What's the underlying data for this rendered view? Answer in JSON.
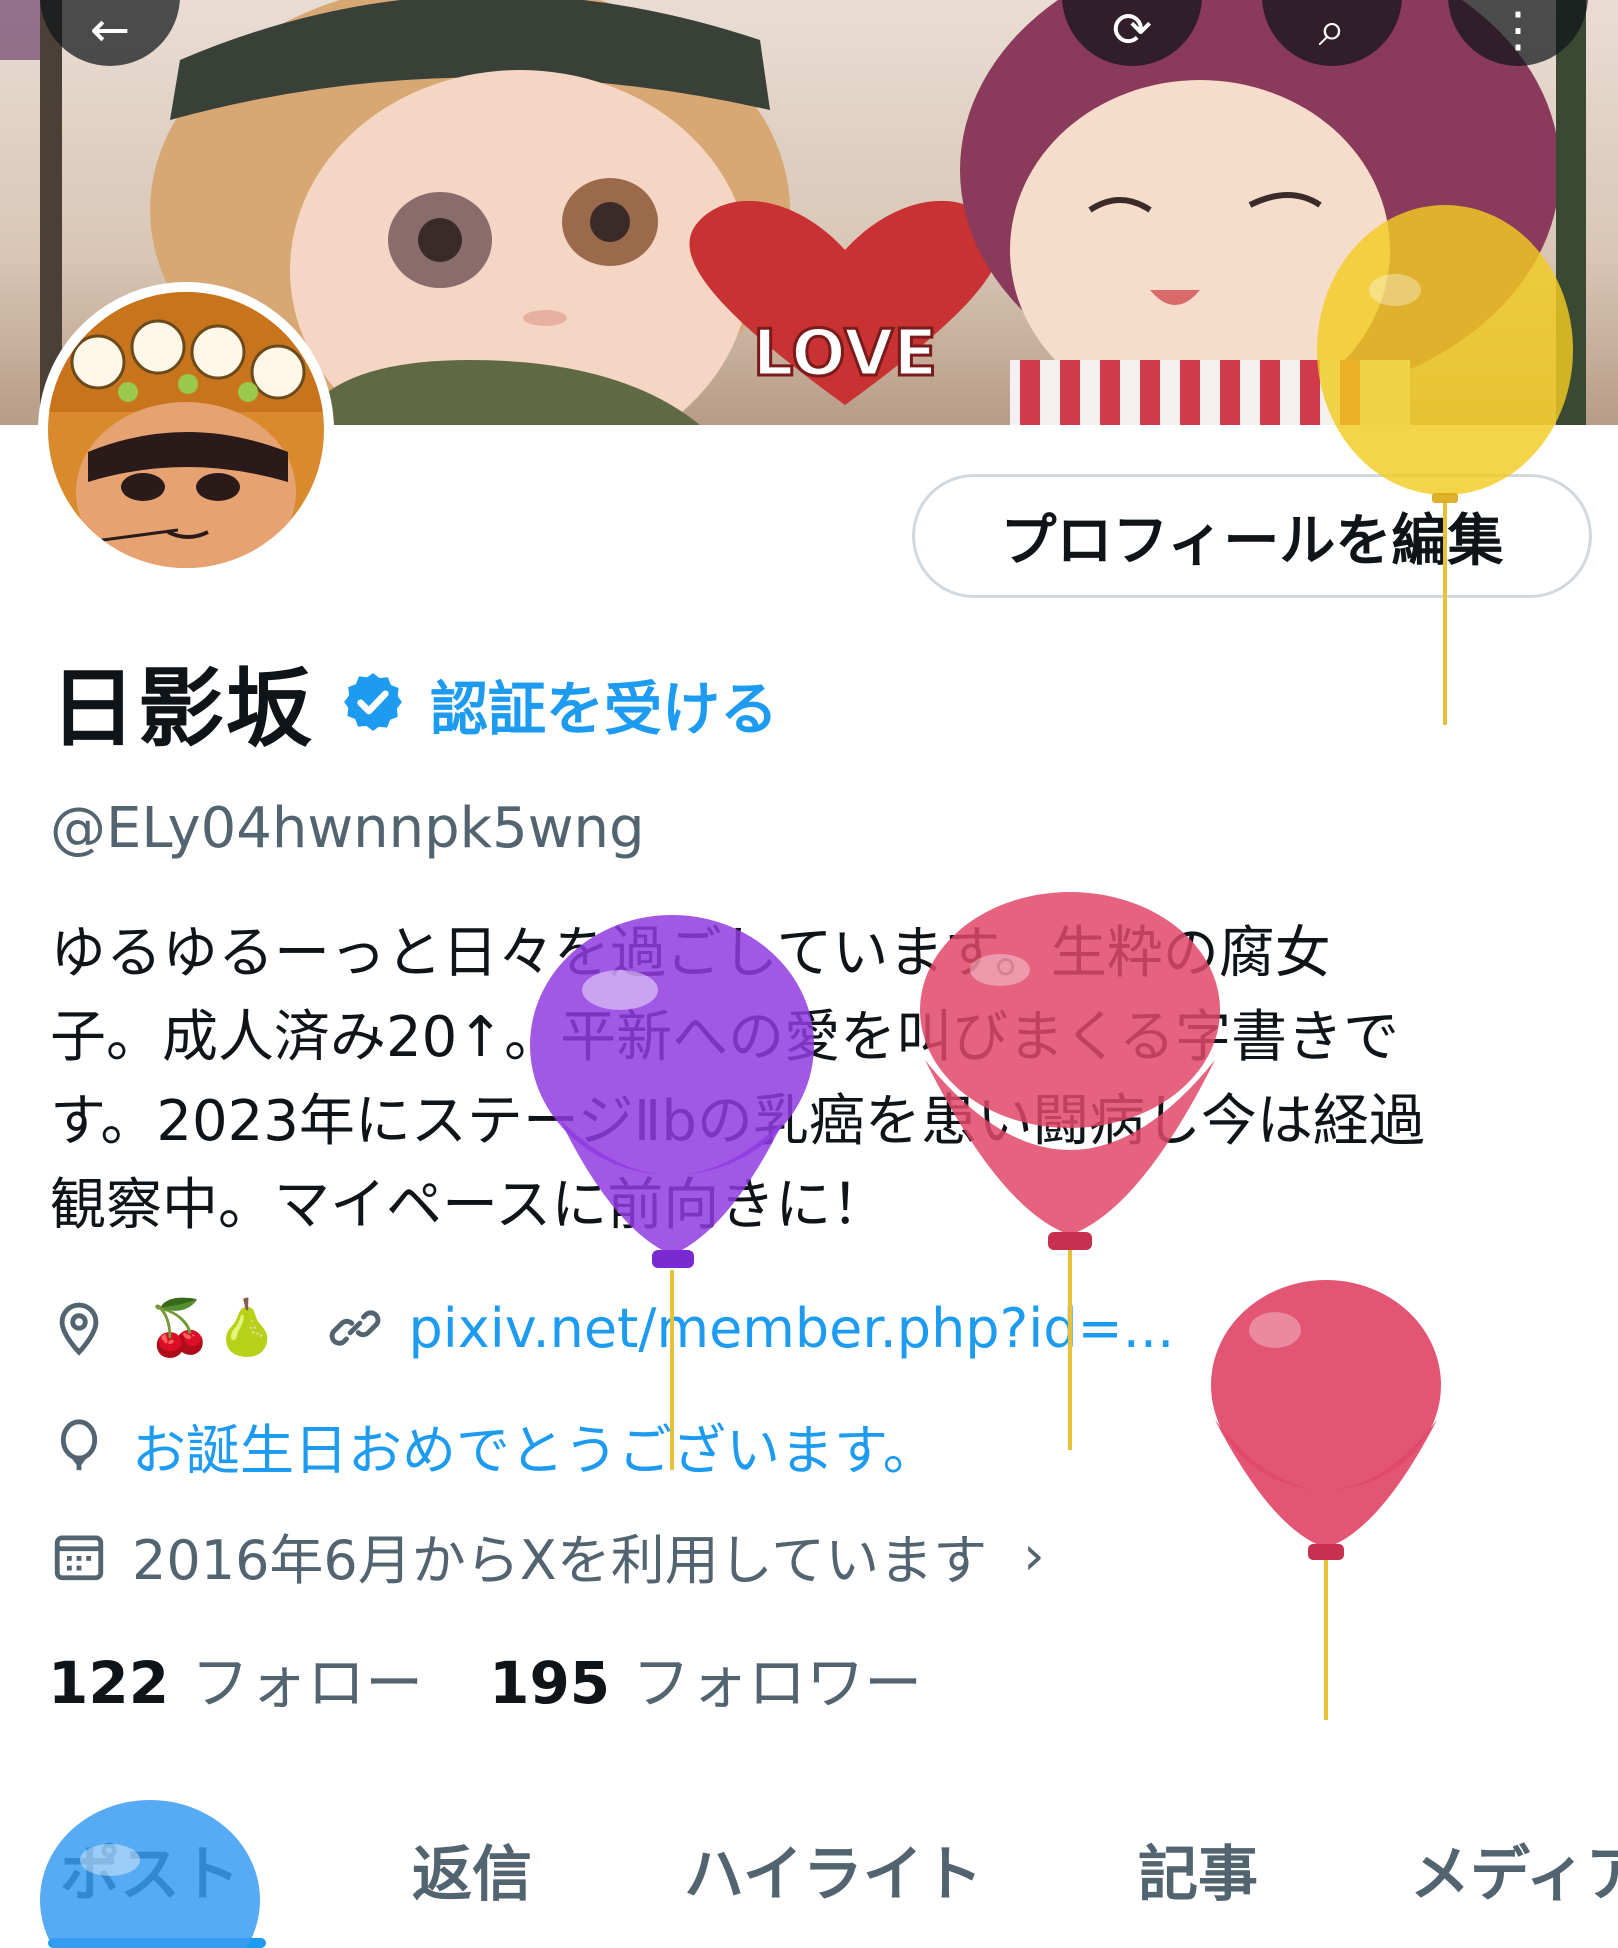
{
  "header": {
    "back_label": "back",
    "repost_label": "repost",
    "search_label": "search",
    "more_label": "more"
  },
  "banner": {
    "heart_text": "LOVE"
  },
  "profile": {
    "edit_button": "プロフィールを編集",
    "display_name": "日影坂",
    "get_verified": "認証を受ける",
    "handle": "@ELy04hwnnpk5wng",
    "bio": "ゆるゆるーっと日々を過ごしています。生粋の腐女\n子。成人済み20↑。平新への愛を叫びまくる字書きで\nす。2023年にステージⅡbの乳癌を患い闘病し今は経過\n観察中。マイペースに前向きに！",
    "location": "🍒🍐",
    "website": "pixiv.net/member.php?id=...",
    "birthday": "お誕生日おめでとうございます。",
    "joined": "2016年6月からXを利用しています"
  },
  "stats": {
    "following_count": "122",
    "following_label": "フォロー",
    "followers_count": "195",
    "followers_label": "フォロワー"
  },
  "tabs": [
    {
      "label": "ポスト"
    },
    {
      "label": "返信"
    },
    {
      "label": "ハイライト"
    },
    {
      "label": "記事"
    },
    {
      "label": "メディア"
    }
  ],
  "colors": {
    "accent": "#1d9bf0",
    "text_primary": "#0f1419",
    "text_secondary": "#536471",
    "border": "#cfd9de"
  },
  "icons": {
    "verified": "verified-badge-icon",
    "location": "location-pin-icon",
    "link": "link-icon",
    "birthday": "balloon-icon",
    "calendar": "calendar-icon"
  }
}
